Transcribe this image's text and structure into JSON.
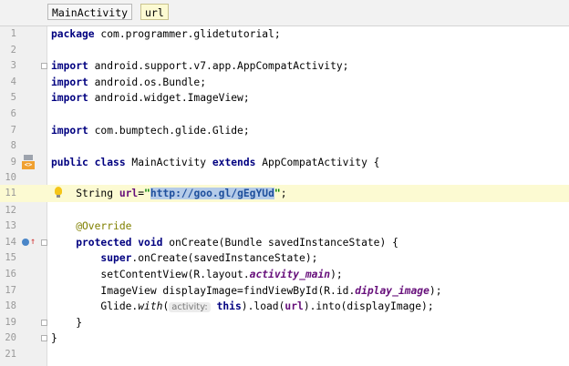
{
  "breadcrumb": {
    "class_name": "MainActivity",
    "field_name": "url"
  },
  "hint": {
    "param_name": "activity:"
  },
  "lines": [
    {
      "n": "1"
    },
    {
      "n": "2"
    },
    {
      "n": "3"
    },
    {
      "n": "4"
    },
    {
      "n": "5"
    },
    {
      "n": "6"
    },
    {
      "n": "7"
    },
    {
      "n": "8"
    },
    {
      "n": "9"
    },
    {
      "n": "10"
    },
    {
      "n": "11"
    },
    {
      "n": "12"
    },
    {
      "n": "13"
    },
    {
      "n": "14"
    },
    {
      "n": "15"
    },
    {
      "n": "16"
    },
    {
      "n": "17"
    },
    {
      "n": "18"
    },
    {
      "n": "19"
    },
    {
      "n": "20"
    },
    {
      "n": "21"
    }
  ],
  "code": {
    "l1_kw": "package",
    "l1_rest": " com.programmer.glidetutorial;",
    "l3_kw": "import",
    "l3_rest": " android.support.v7.app.AppCompatActivity;",
    "l4_kw": "import",
    "l4_rest": " android.os.Bundle;",
    "l5_kw": "import",
    "l5_rest": " android.widget.ImageView;",
    "l7_kw": "import",
    "l7_rest": " com.bumptech.glide.Glide;",
    "l9_kw1": "public class",
    "l9_mid": " MainActivity ",
    "l9_kw2": "extends",
    "l9_rest": " AppCompatActivity {",
    "l11_pre": "    String ",
    "l11_var": "url",
    "l11_eq": "=",
    "l11_q1": "\"",
    "l11_sel": "http://goo.gl/gEgYUd",
    "l11_q2": "\"",
    "l11_end": ";",
    "l13_ann": "    @Override",
    "l14_kw": "    protected void",
    "l14_rest": " onCreate(Bundle savedInstanceState) {",
    "l15_kw": "        super",
    "l15_rest": ".onCreate(savedInstanceState);",
    "l16_pre": "        setContentView(R.layout.",
    "l16_fld": "activity_main",
    "l16_end": ");",
    "l17_pre": "        ImageView displayImage=findViewById(R.id.",
    "l17_fld": "diplay_image",
    "l17_end": ");",
    "l18_pre": "        Glide.",
    "l18_ital": "with",
    "l18_open": "(",
    "l18_kw": "this",
    "l18_mid": ").load(",
    "l18_var": "url",
    "l18_end": ").into(displayImage);",
    "l19": "    }",
    "l20": "}"
  },
  "colors": {
    "keyword": "#000080",
    "string": "#008000",
    "annotation": "#808000",
    "field": "#660e7a",
    "caret_row": "#fcfad2",
    "selection": "#b5cbe8"
  }
}
